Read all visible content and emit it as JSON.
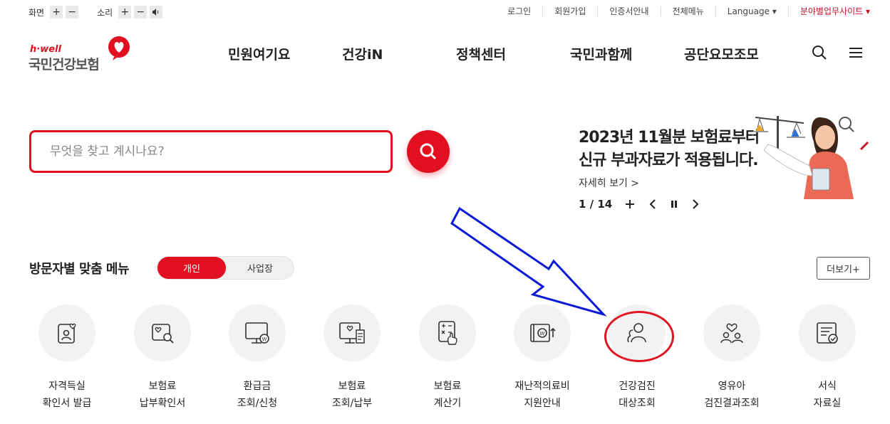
{
  "utility": {
    "screen_label": "화면",
    "sound_label": "소리",
    "plus": "+",
    "minus": "−",
    "links": [
      "로그인",
      "회원가입",
      "인증서안내",
      "전체메뉴",
      "Language ▾",
      "분야별업무사이트 ▾"
    ]
  },
  "logo": {
    "tagline": "h·well",
    "name": "국민건강보험"
  },
  "gnb": {
    "items": [
      "민원여기요",
      "건강iN",
      "정책센터",
      "국민과함께",
      "공단요모조모"
    ]
  },
  "search": {
    "placeholder": "무엇을 찾고 계시나요?"
  },
  "banner": {
    "line1": "2023년 11월분 보험료부터",
    "line2": "신규 부과자료가 적용됩니다.",
    "more": "자세히 보기 >",
    "page": "1 / 14"
  },
  "visitor_menu": {
    "title": "방문자별 맞춤 메뉴",
    "tab_personal": "개인",
    "tab_business": "사업장",
    "more": "더보기+",
    "items": [
      {
        "line1": "자격득실",
        "line2": "확인서 발급",
        "icon": "id-card-heart-icon"
      },
      {
        "line1": "보험료",
        "line2": "납부확인서",
        "icon": "document-search-icon"
      },
      {
        "line1": "환급금",
        "line2": "조회/신청",
        "icon": "monitor-won-icon"
      },
      {
        "line1": "보험료",
        "line2": "조회/납부",
        "icon": "monitor-receipt-icon"
      },
      {
        "line1": "보험료",
        "line2": "계산기",
        "icon": "calculator-hand-icon"
      },
      {
        "line1": "재난적의료비",
        "line2": "지원안내",
        "icon": "won-support-icon"
      },
      {
        "line1": "건강검진",
        "line2": "대상조회",
        "icon": "people-icon"
      },
      {
        "line1": "영유아",
        "line2": "검진결과조회",
        "icon": "family-heart-icon"
      },
      {
        "line1": "서식",
        "line2": "자료실",
        "icon": "form-check-icon"
      }
    ]
  },
  "colors": {
    "brand_red": "#e10f1f",
    "annotation_blue": "#0a1ad8",
    "annotation_red": "#e0151f"
  }
}
